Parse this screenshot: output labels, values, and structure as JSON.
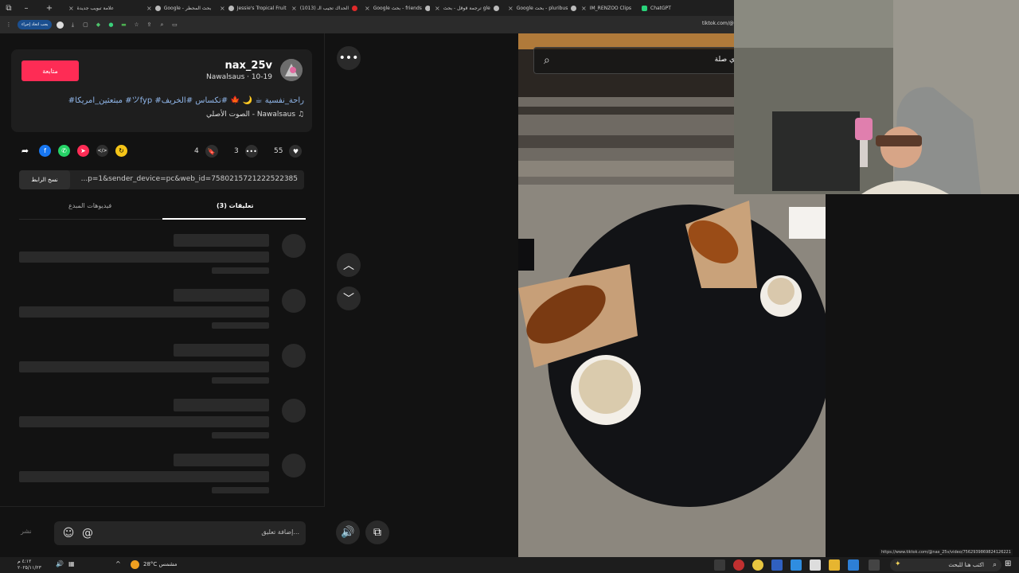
{
  "browser": {
    "tabs": [
      {
        "label": "علامة تبويب جديدة"
      },
      {
        "label": "Google - بحث المحظر"
      },
      {
        "label": "Jessie's Tropical Fruit"
      },
      {
        "label": "(1013) الحداك تجيب الـ"
      },
      {
        "label": "Google بحث - friends"
      },
      {
        "label": "ترجمة قوقل - بحث gle"
      },
      {
        "label": "Google بحث - pluribus"
      },
      {
        "label": "IM_RENZOO Clips"
      },
      {
        "label": "ChatGPT"
      }
    ],
    "profile_pill": "يجب اتخاذ إجراء",
    "url": "tiktok.com/@"
  },
  "post": {
    "username": "nax_25v",
    "nick_line": "Nawalsaus · 10-19",
    "follow_label": "متابعة",
    "caption": "#مبتعثين_امريكا #ツfyp #راحة_نفسية ☕ 🌙 🍁 #تكساس #الخريف",
    "music": "الصوت الأصلي - Nawalsaus",
    "likes": "55",
    "comments": "3",
    "saves": "4",
    "link": "...p=1&sender_device=pc&web_id=7580215721222522385",
    "copy_link_label": "نسخ الرابط",
    "tab_comments": "تعليقات (3)",
    "tab_creator": "فيديوهات المبدع",
    "comment_placeholder": "إضافة تعليق...",
    "post_label": "نشر"
  },
  "video": {
    "search_text": "ي صلة"
  },
  "status_url": "https://www.tiktok.com/@nax_25v/video/7562939869824126221",
  "taskbar": {
    "weather": "28°C مشمس",
    "time": "٤:١٢ م",
    "date": "٢٠٢٥/١١/٢٣",
    "search_placeholder": "اكتب هنا للبحث"
  }
}
